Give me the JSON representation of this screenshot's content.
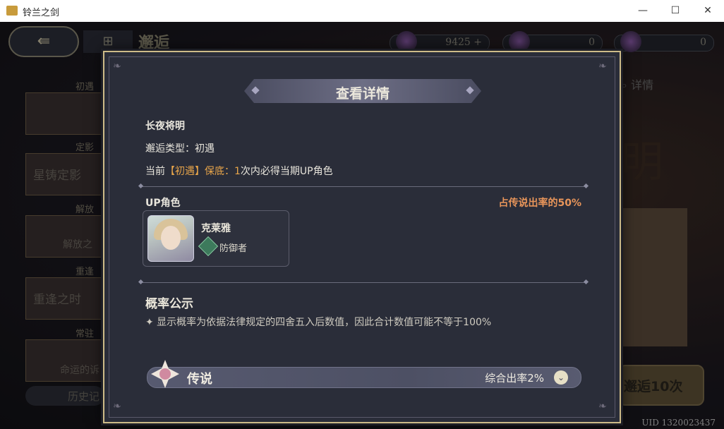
{
  "window": {
    "title": "铃兰之剑",
    "minimize": "—",
    "maximize": "☐",
    "close": "✕"
  },
  "background": {
    "page_title": "邂逅",
    "back_icon": "back-arrow-icon",
    "currencies": [
      {
        "value": "9425 +"
      },
      {
        "value": "0"
      },
      {
        "value": "0"
      }
    ],
    "banners": [
      {
        "tag": "初遇",
        "text": ""
      },
      {
        "tag": "定影",
        "text": "星铸定影"
      },
      {
        "tag": "解放",
        "text": "解放之"
      },
      {
        "tag": "重逢",
        "text": "重逢之时"
      },
      {
        "tag": "常驻",
        "text": "命运的诉"
      }
    ],
    "history": "历史记",
    "detail": "详情",
    "right_big_char": "明",
    "pull_button": "邂逅10次",
    "uid": "UID 1320023437"
  },
  "modal": {
    "title": "查看详情",
    "banner_name": "长夜将明",
    "type_line": "邂逅类型：初遇",
    "pity": {
      "prefix": "当前",
      "tag": "【初遇】",
      "label": "保底：",
      "count": "1",
      "suffix": "次内必得当期UP角色"
    },
    "up_section": {
      "label": "UP角色",
      "share": "占传说出率的50%"
    },
    "character": {
      "name": "克莱雅",
      "role": "防御者"
    },
    "probability": {
      "title": "概率公示",
      "note": "✦ 显示概率为依据法律规定的四舍五入后数值，因此合计数值可能不等于100%"
    },
    "legend_row": {
      "label": "传说",
      "rate": "综合出率2%",
      "chevron": "⌄"
    }
  },
  "colors": {
    "accent_gold": "#cdbb88",
    "highlight_orange": "#e8a54a",
    "share_orange": "#e8955a",
    "modal_bg": "#2a2d39"
  }
}
